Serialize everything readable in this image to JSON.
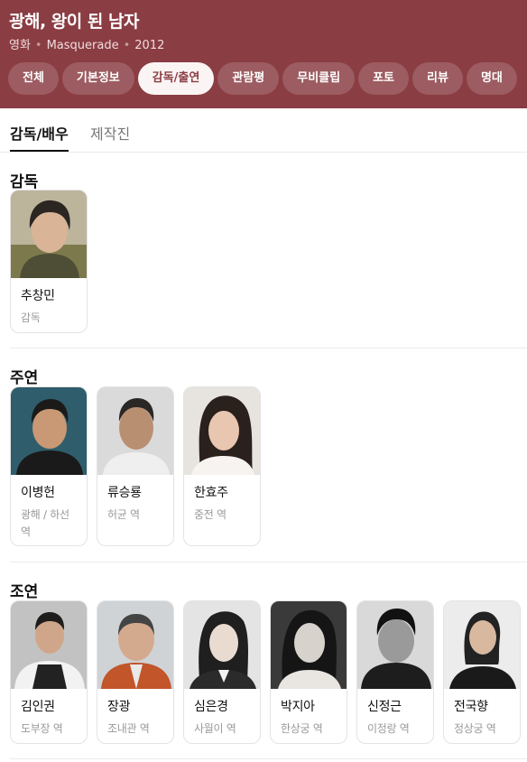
{
  "header": {
    "title": "광해, 왕이 된 남자",
    "category": "영화",
    "english_title": "Masquerade",
    "year": "2012",
    "colors": {
      "header_bg": "#8a3d43",
      "active_tab_bg": "#fbf4f4"
    },
    "tabs": [
      {
        "label": "전체"
      },
      {
        "label": "기본정보"
      },
      {
        "label": "감독/출연",
        "active": true
      },
      {
        "label": "관람평"
      },
      {
        "label": "무비클립"
      },
      {
        "label": "포토"
      },
      {
        "label": "리뷰"
      },
      {
        "label": "명대"
      }
    ]
  },
  "subtabs": [
    {
      "label": "감독/배우",
      "active": true
    },
    {
      "label": "제작진"
    }
  ],
  "sections": {
    "director": {
      "title": "감독",
      "people": [
        {
          "name": "추창민",
          "role": "감독"
        }
      ]
    },
    "lead": {
      "title": "주연",
      "people": [
        {
          "name": "이병헌",
          "role": "광해 / 하선 역"
        },
        {
          "name": "류승룡",
          "role": "허균 역"
        },
        {
          "name": "한효주",
          "role": "중전 역"
        }
      ]
    },
    "supporting": {
      "title": "조연",
      "people": [
        {
          "name": "김인권",
          "role": "도부장 역"
        },
        {
          "name": "장광",
          "role": "조내관 역"
        },
        {
          "name": "심은경",
          "role": "사월이 역"
        },
        {
          "name": "박지아",
          "role": "한상궁 역"
        },
        {
          "name": "신정근",
          "role": "이정랑 역"
        },
        {
          "name": "전국향",
          "role": "정상궁 역"
        }
      ]
    }
  }
}
